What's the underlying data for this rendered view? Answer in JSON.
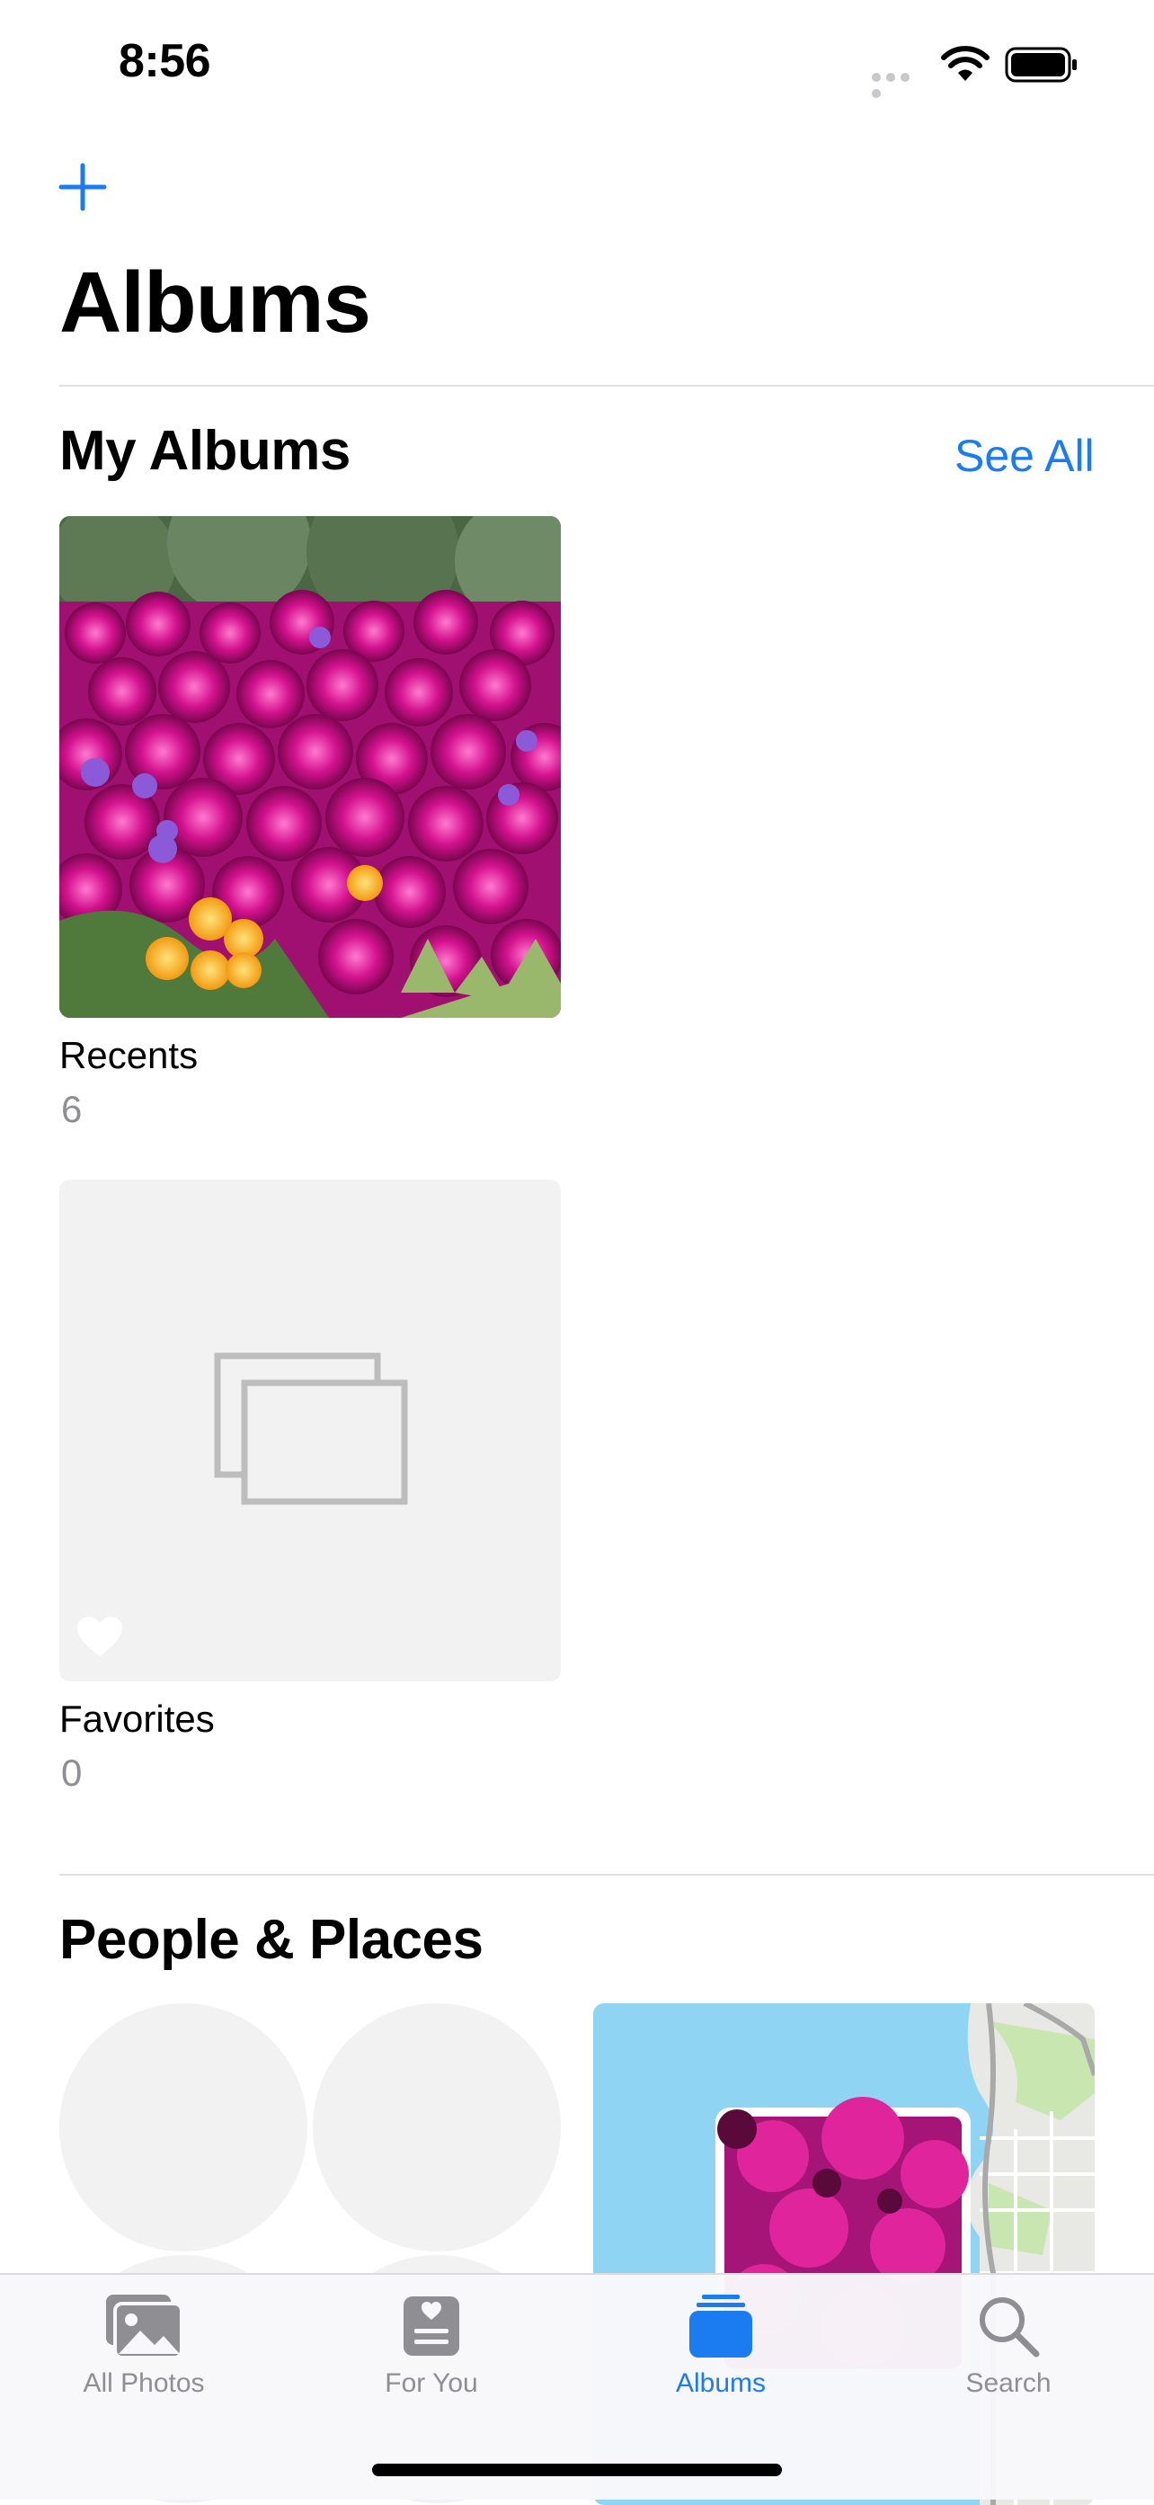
{
  "status_bar": {
    "time": "8:56"
  },
  "nav": {
    "title": "Albums",
    "add_icon": "plus-icon"
  },
  "my_albums": {
    "title": "My Albums",
    "see_all": "See All",
    "albums": [
      {
        "name": "Recents",
        "count": "6",
        "thumbnail": "pink-flowers-photo"
      },
      {
        "name": "Favorites",
        "count": "0",
        "thumbnail": "empty-album-placeholder",
        "badge_icon": "heart-icon"
      }
    ]
  },
  "people_places": {
    "title": "People & Places"
  },
  "tab_bar": {
    "tabs": [
      {
        "label": "All Photos",
        "icon": "photos-icon",
        "active": false
      },
      {
        "label": "For You",
        "icon": "for-you-icon",
        "active": false
      },
      {
        "label": "Albums",
        "icon": "albums-icon",
        "active": true
      },
      {
        "label": "Search",
        "icon": "search-icon",
        "active": false
      }
    ]
  },
  "colors": {
    "accent": "#1a7cf0",
    "secondary_text": "#8e8e93",
    "placeholder_bg": "#f2f2f2"
  }
}
